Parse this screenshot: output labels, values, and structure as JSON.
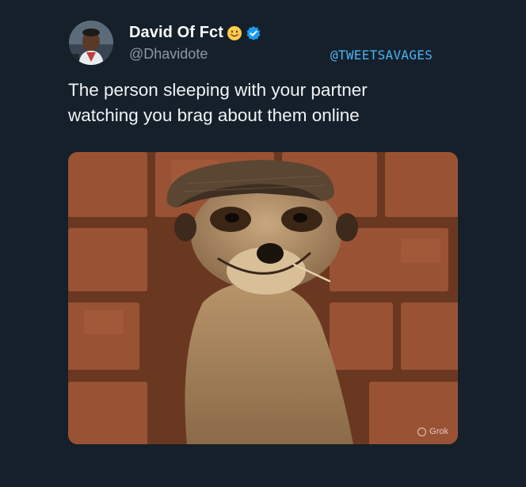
{
  "author": {
    "display_name": "David Of Fct",
    "handle": "@Dhavidote",
    "avatar_icon": "avatar-photo",
    "emoji_icon": "smiling-face-emoji-icon",
    "verified_icon": "verified-badge-icon"
  },
  "watermark": "@TWEETSAVAGES",
  "tweet": {
    "text": "The person sleeping with your partner\nwatching you brag about them online"
  },
  "media": {
    "description_icon": "meerkat-photo",
    "badge": "Grok"
  },
  "colors": {
    "background": "#15202b",
    "verified": "#1d9bf0",
    "watermark": "#4ab3f4",
    "handle": "#8b98a5"
  }
}
